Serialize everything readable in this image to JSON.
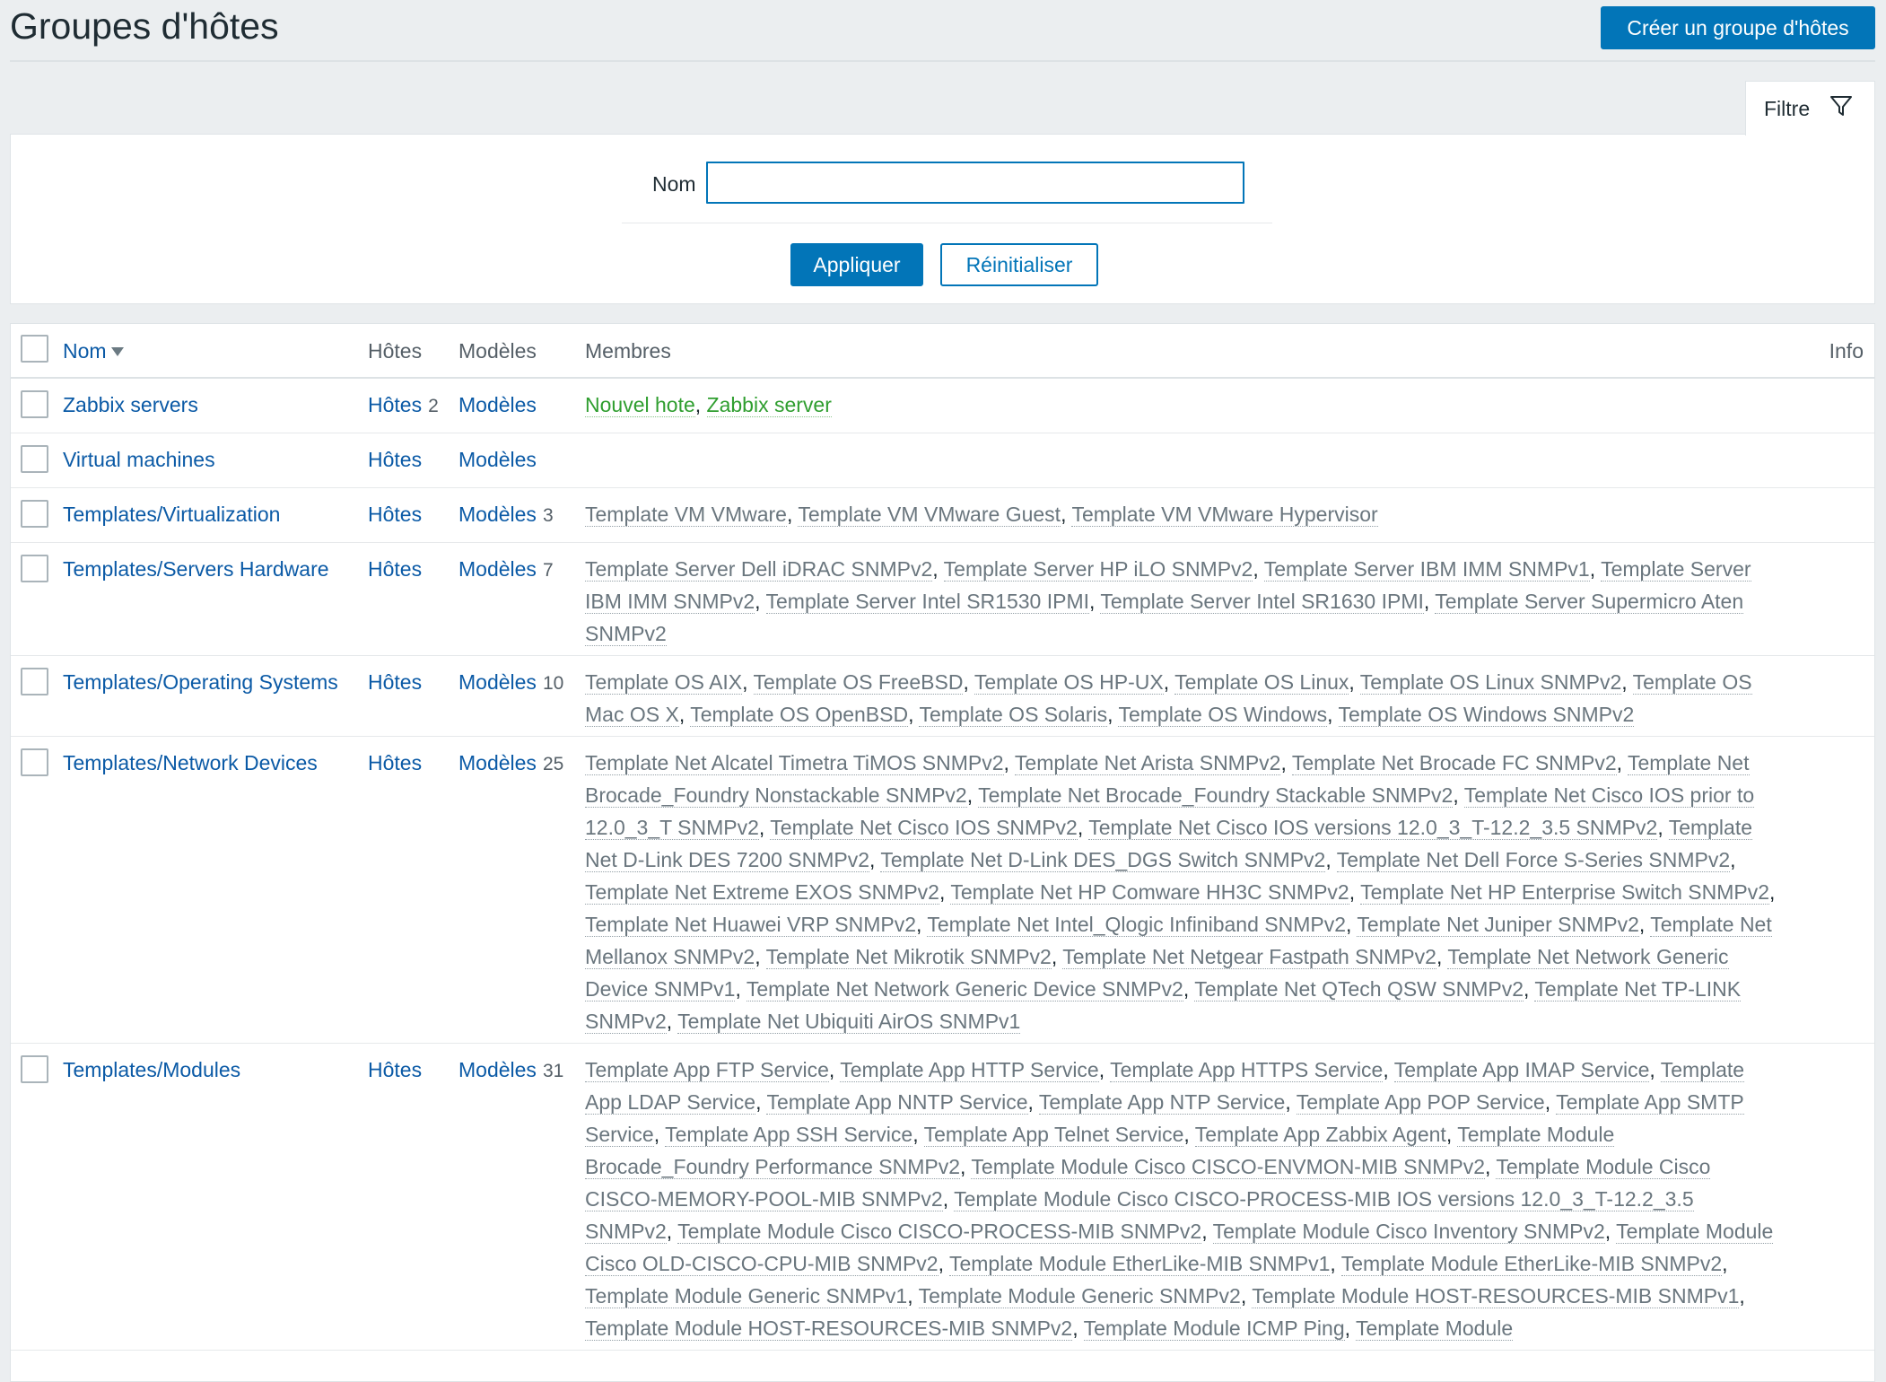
{
  "header": {
    "title": "Groupes d'hôtes",
    "create_button": "Créer un groupe d'hôtes"
  },
  "filter": {
    "tab_label": "Filtre",
    "name_label": "Nom",
    "name_value": "",
    "apply": "Appliquer",
    "reset": "Réinitialiser"
  },
  "table": {
    "columns": {
      "name": "Nom",
      "hosts": "Hôtes",
      "models": "Modèles",
      "members": "Membres",
      "info": "Info"
    },
    "rows": [
      {
        "name": "Zabbix servers",
        "hosts": "Hôtes",
        "hosts_count": "2",
        "models": "Modèles",
        "models_count": "",
        "member_type": "host",
        "members": [
          "Nouvel hote",
          "Zabbix server"
        ]
      },
      {
        "name": "Virtual machines",
        "hosts": "Hôtes",
        "hosts_count": "",
        "models": "Modèles",
        "models_count": "",
        "member_type": "template",
        "members": []
      },
      {
        "name": "Templates/Virtualization",
        "hosts": "Hôtes",
        "hosts_count": "",
        "models": "Modèles",
        "models_count": "3",
        "member_type": "template",
        "members": [
          "Template VM VMware",
          "Template VM VMware Guest",
          "Template VM VMware Hypervisor"
        ]
      },
      {
        "name": "Templates/Servers Hardware",
        "hosts": "Hôtes",
        "hosts_count": "",
        "models": "Modèles",
        "models_count": "7",
        "member_type": "template",
        "members": [
          "Template Server Dell iDRAC SNMPv2",
          "Template Server HP iLO SNMPv2",
          "Template Server IBM IMM SNMPv1",
          "Template Server IBM IMM SNMPv2",
          "Template Server Intel SR1530 IPMI",
          "Template Server Intel SR1630 IPMI",
          "Template Server Supermicro Aten SNMPv2"
        ]
      },
      {
        "name": "Templates/Operating Systems",
        "hosts": "Hôtes",
        "hosts_count": "",
        "models": "Modèles",
        "models_count": "10",
        "member_type": "template",
        "members": [
          "Template OS AIX",
          "Template OS FreeBSD",
          "Template OS HP-UX",
          "Template OS Linux",
          "Template OS Linux SNMPv2",
          "Template OS Mac OS X",
          "Template OS OpenBSD",
          "Template OS Solaris",
          "Template OS Windows",
          "Template OS Windows SNMPv2"
        ]
      },
      {
        "name": "Templates/Network Devices",
        "hosts": "Hôtes",
        "hosts_count": "",
        "models": "Modèles",
        "models_count": "25",
        "member_type": "template",
        "members": [
          "Template Net Alcatel Timetra TiMOS SNMPv2",
          "Template Net Arista SNMPv2",
          "Template Net Brocade FC SNMPv2",
          "Template Net Brocade_Foundry Nonstackable SNMPv2",
          "Template Net Brocade_Foundry Stackable SNMPv2",
          "Template Net Cisco IOS prior to 12.0_3_T SNMPv2",
          "Template Net Cisco IOS SNMPv2",
          "Template Net Cisco IOS versions 12.0_3_T-12.2_3.5 SNMPv2",
          "Template Net D-Link DES 7200 SNMPv2",
          "Template Net D-Link DES_DGS Switch SNMPv2",
          "Template Net Dell Force S-Series SNMPv2",
          "Template Net Extreme EXOS SNMPv2",
          "Template Net HP Comware HH3C SNMPv2",
          "Template Net HP Enterprise Switch SNMPv2",
          "Template Net Huawei VRP SNMPv2",
          "Template Net Intel_Qlogic Infiniband SNMPv2",
          "Template Net Juniper SNMPv2",
          "Template Net Mellanox SNMPv2",
          "Template Net Mikrotik SNMPv2",
          "Template Net Netgear Fastpath SNMPv2",
          "Template Net Network Generic Device SNMPv1",
          "Template Net Network Generic Device SNMPv2",
          "Template Net QTech QSW SNMPv2",
          "Template Net TP-LINK SNMPv2",
          "Template Net Ubiquiti AirOS SNMPv1"
        ]
      },
      {
        "name": "Templates/Modules",
        "hosts": "Hôtes",
        "hosts_count": "",
        "models": "Modèles",
        "models_count": "31",
        "member_type": "template",
        "members": [
          "Template App FTP Service",
          "Template App HTTP Service",
          "Template App HTTPS Service",
          "Template App IMAP Service",
          "Template App LDAP Service",
          "Template App NNTP Service",
          "Template App NTP Service",
          "Template App POP Service",
          "Template App SMTP Service",
          "Template App SSH Service",
          "Template App Telnet Service",
          "Template App Zabbix Agent",
          "Template Module Brocade_Foundry Performance SNMPv2",
          "Template Module Cisco CISCO-ENVMON-MIB SNMPv2",
          "Template Module Cisco CISCO-MEMORY-POOL-MIB SNMPv2",
          "Template Module Cisco CISCO-PROCESS-MIB IOS versions 12.0_3_T-12.2_3.5 SNMPv2",
          "Template Module Cisco CISCO-PROCESS-MIB SNMPv2",
          "Template Module Cisco Inventory SNMPv2",
          "Template Module Cisco OLD-CISCO-CPU-MIB SNMPv2",
          "Template Module EtherLike-MIB SNMPv1",
          "Template Module EtherLike-MIB SNMPv2",
          "Template Module Generic SNMPv1",
          "Template Module Generic SNMPv2",
          "Template Module HOST-RESOURCES-MIB SNMPv1",
          "Template Module HOST-RESOURCES-MIB SNMPv2",
          "Template Module ICMP Ping",
          "Template Module"
        ]
      }
    ]
  },
  "icons": {
    "filter": "funnel-icon",
    "sort": "sort-descending-icon"
  },
  "colors": {
    "accent": "#0275b8",
    "link": "#0b5aa6",
    "host_member": "#2f9e2f",
    "template_member": "#6a767e",
    "background": "#ebeef0"
  }
}
